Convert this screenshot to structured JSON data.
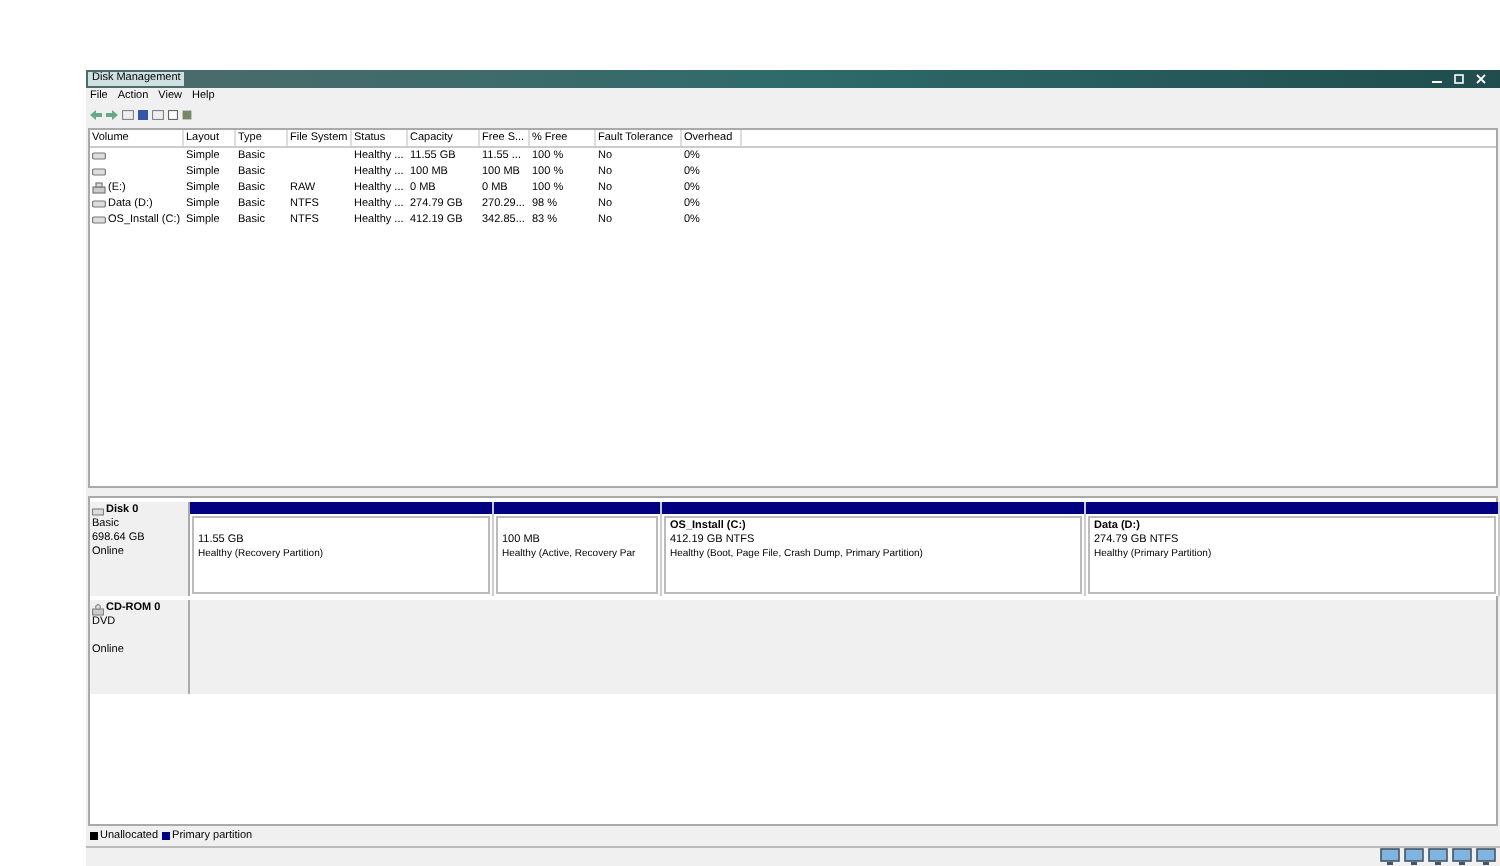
{
  "window": {
    "title": "Disk Management"
  },
  "menu": [
    "File",
    "Action",
    "View",
    "Help"
  ],
  "table": {
    "columns": [
      "Volume",
      "Layout",
      "Type",
      "File System",
      "Status",
      "Capacity",
      "Free S...",
      "% Free",
      "Fault Tolerance",
      "Overhead"
    ],
    "rows": [
      {
        "kind": "disk",
        "cells": [
          "",
          "Simple",
          "Basic",
          "",
          "Healthy ...",
          "11.55 GB",
          "11.55 ...",
          "100 %",
          "No",
          "0%"
        ]
      },
      {
        "kind": "disk",
        "cells": [
          "",
          "Simple",
          "Basic",
          "",
          "Healthy ...",
          "100 MB",
          "100 MB",
          "100 %",
          "No",
          "0%"
        ]
      },
      {
        "kind": "removable",
        "cells": [
          "(E:)",
          "Simple",
          "Basic",
          "RAW",
          "Healthy ...",
          "0 MB",
          "0 MB",
          "100 %",
          "No",
          "0%"
        ]
      },
      {
        "kind": "disk",
        "cells": [
          "Data (D:)",
          "Simple",
          "Basic",
          "NTFS",
          "Healthy ...",
          "274.79 GB",
          "270.29...",
          "98 %",
          "No",
          "0%"
        ]
      },
      {
        "kind": "disk",
        "cells": [
          "OS_Install (C:)",
          "Simple",
          "Basic",
          "NTFS",
          "Healthy ...",
          "412.19 GB",
          "342.85...",
          "83 %",
          "No",
          "0%"
        ]
      }
    ]
  },
  "disks": [
    {
      "kind": "disk",
      "name": "Disk 0",
      "lines": [
        "Basic",
        "698.64 GB",
        "Online"
      ],
      "partitions": [
        {
          "size": "11.55 GB",
          "status": "Healthy (Recovery Partition)"
        },
        {
          "size": "100 MB",
          "status": "Healthy (Active, Recovery Par"
        },
        {
          "name": "OS_Install  (C:)",
          "size": "412.19 GB NTFS",
          "status": "Healthy (Boot, Page File, Crash Dump, Primary Partition)"
        },
        {
          "name": "Data  (D:)",
          "size": "274.79 GB NTFS",
          "status": "Healthy (Primary Partition)"
        }
      ]
    },
    {
      "kind": "cdrom",
      "name": "CD-ROM 0",
      "lines": [
        "DVD",
        "Online"
      ]
    }
  ],
  "legend": [
    {
      "label": "Unallocated",
      "color": "#000000"
    },
    {
      "label": "Primary partition",
      "color": "#000080"
    }
  ]
}
